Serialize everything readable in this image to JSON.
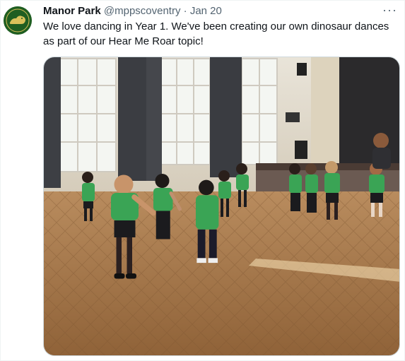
{
  "tweet": {
    "display_name": "Manor Park",
    "handle": "@mppscoventry",
    "separator": "·",
    "date": "Jan 20",
    "more_label": "···",
    "text": "We love dancing in Year 1. We've been creating our own dinosaur dances as part of our Hear Me Roar topic!",
    "avatar_icon": "school-crest-icon",
    "media_icon": "photo-children-dancing-icon"
  },
  "colors": {
    "brand_green": "#1f5e21",
    "text": "#0f1419",
    "secondary": "#536471",
    "border": "#cfd9de"
  }
}
